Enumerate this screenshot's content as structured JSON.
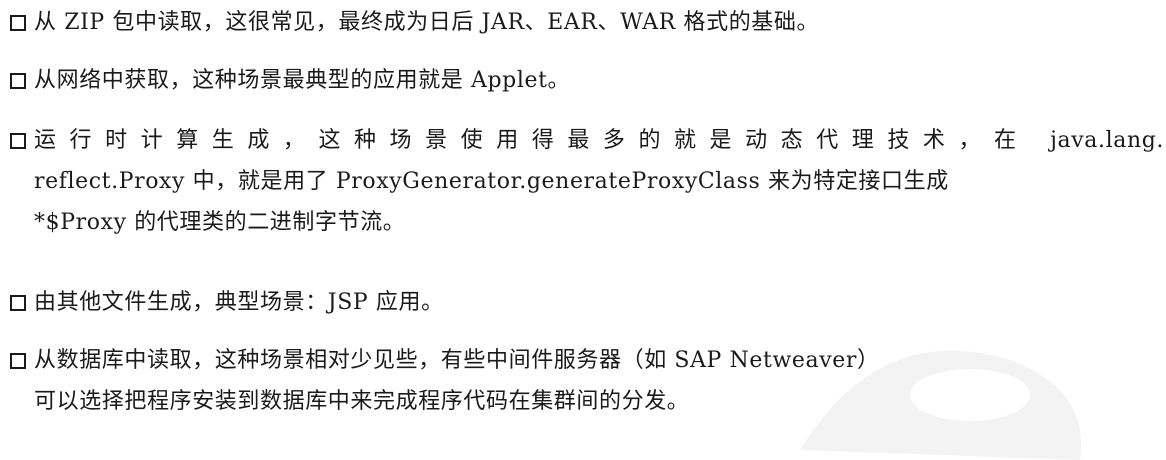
{
  "items": [
    {
      "lines": [
        "从 ZIP 包中读取，这很常见，最终成为日后 JAR、EAR、WAR 格式的基础。"
      ]
    },
    {
      "lines": [
        "从网络中获取，这种场景最典型的应用就是 Applet。"
      ]
    },
    {
      "lines": [
        "运行时计算生成，这种场景使用得最多的就是动态代理技术，在 java.lang.",
        "reflect.Proxy 中，就是用了 ProxyGenerator.generateProxyClass 来为特定接口生成",
        "*$Proxy 的代理类的二进制字节流。"
      ]
    },
    {
      "lines": [
        "由其他文件生成，典型场景：JSP 应用。"
      ]
    },
    {
      "lines": [
        "从数据库中读取，这种场景相对少见些，有些中间件服务器（如 SAP Netweaver）",
        "可以选择把程序安装到数据库中来完成程序代码在集群间的分发。"
      ]
    }
  ]
}
